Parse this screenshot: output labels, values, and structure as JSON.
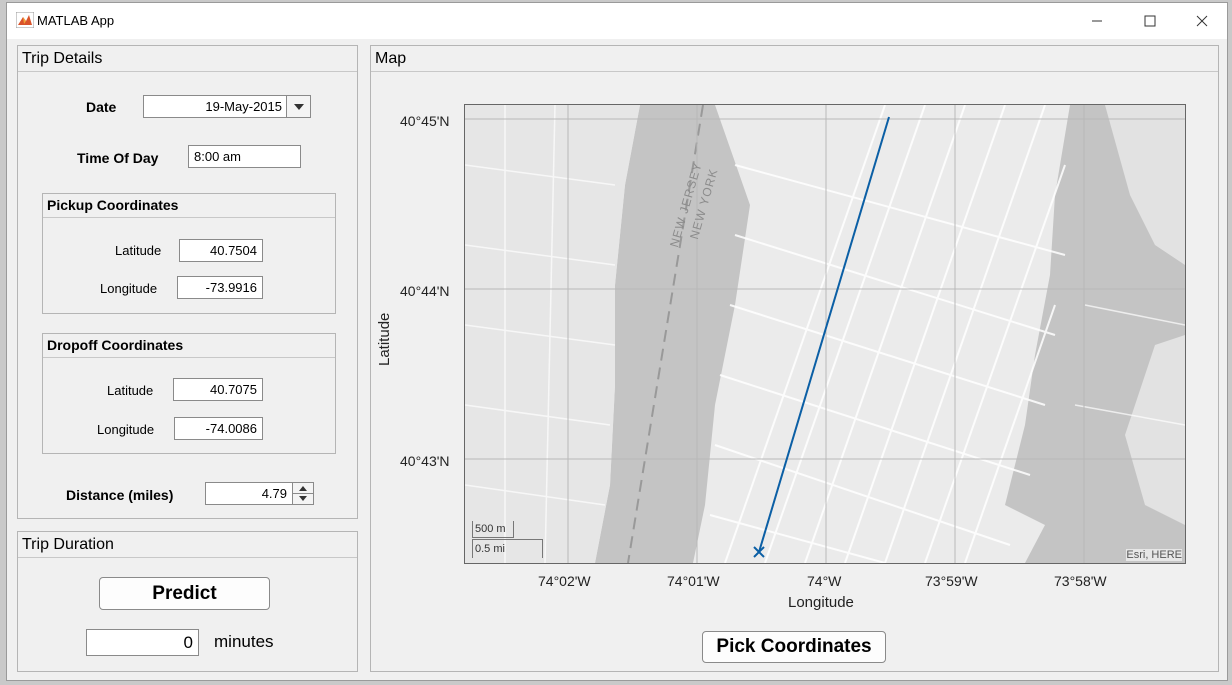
{
  "window": {
    "title": "MATLAB App"
  },
  "trip_details": {
    "title": "Trip Details",
    "date_label": "Date",
    "date_value": "19-May-2015",
    "time_label": "Time Of Day",
    "time_value": "8:00 am",
    "pickup": {
      "title": "Pickup Coordinates",
      "lat_label": "Latitude",
      "lat_value": "40.7504",
      "lon_label": "Longitude",
      "lon_value": "-73.9916"
    },
    "dropoff": {
      "title": "Dropoff Coordinates",
      "lat_label": "Latitude",
      "lat_value": "40.7075",
      "lon_label": "Longitude",
      "lon_value": "-74.0086"
    },
    "distance_label": "Distance (miles)",
    "distance_value": "4.79"
  },
  "trip_duration": {
    "title": "Trip Duration",
    "predict_label": "Predict",
    "minutes_value": "0",
    "minutes_label": "minutes"
  },
  "map": {
    "title": "Map",
    "ylabel": "Latitude",
    "xlabel": "Longitude",
    "lat_ticks": [
      "40°45'N",
      "40°44'N",
      "40°43'N"
    ],
    "lon_ticks": [
      "74°02'W",
      "74°01'W",
      "74°W",
      "73°59'W",
      "73°58'W"
    ],
    "scale_m": "500 m",
    "scale_mi": "0.5 mi",
    "attribution": "Esri, HERE",
    "label_nj": "NEW JERSEY",
    "label_ny": "NEW YORK",
    "pick_label": "Pick Coordinates",
    "route_color": "#0b5fa5"
  }
}
